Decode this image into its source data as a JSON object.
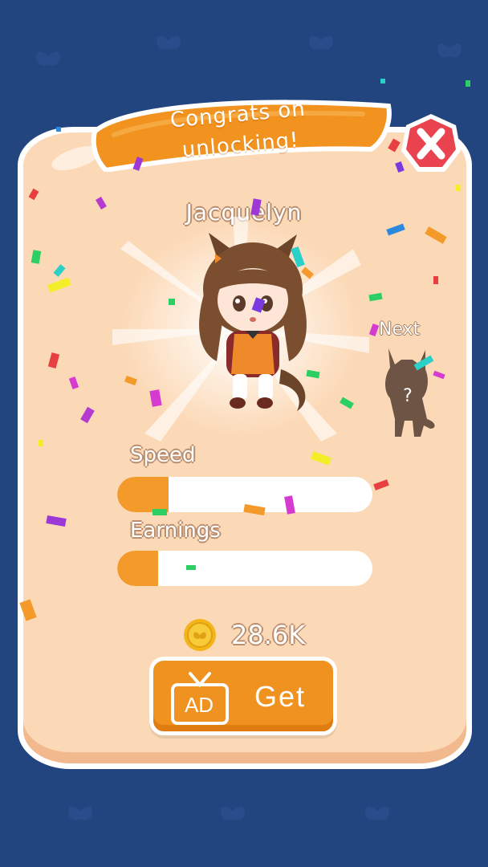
{
  "colors": {
    "background": "#22457f",
    "panel": "#fcd9b6",
    "accent_orange": "#f39a2a",
    "close_red": "#e8434f"
  },
  "banner": {
    "line1": "Congrats on",
    "line2": "unlocking!"
  },
  "character": {
    "name": "Jacquelyn",
    "icon": "character-portrait-icon"
  },
  "next": {
    "label": "Next",
    "icon": "locked-character-silhouette-icon",
    "mystery": "?"
  },
  "stats": [
    {
      "label": "Speed",
      "level": 0.2
    },
    {
      "label": "Earnings",
      "level": 0.16
    }
  ],
  "price": {
    "icon": "butterfly-coin-icon",
    "amount": "28.6K"
  },
  "get_button": {
    "ad_label": "AD",
    "label": "Get",
    "icon": "tv-ad-icon"
  },
  "close_button": {
    "icon": "close-icon"
  }
}
